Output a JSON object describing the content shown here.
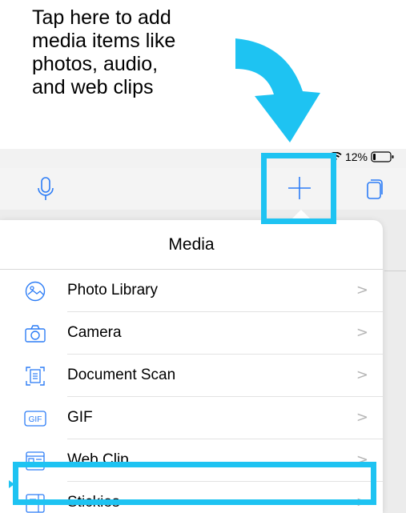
{
  "callout": {
    "text": "Tap here to add\nmedia items like\nphotos, audio,\nand web clips"
  },
  "status": {
    "battery": "12%"
  },
  "colors": {
    "accent": "#1ec3f2",
    "icon": "#2d7df6"
  },
  "toolbar": {
    "mic_icon": "microphone-icon",
    "add_icon": "plus-icon",
    "pages_icon": "pages-icon"
  },
  "popover": {
    "title": "Media",
    "items": [
      {
        "label": "Photo Library",
        "icon": "photo-library-icon"
      },
      {
        "label": "Camera",
        "icon": "camera-icon"
      },
      {
        "label": "Document Scan",
        "icon": "document-scan-icon"
      },
      {
        "label": "GIF",
        "icon": "gif-icon"
      },
      {
        "label": "Web Clip",
        "icon": "web-clip-icon"
      },
      {
        "label": "Stickies",
        "icon": "stickies-icon"
      }
    ],
    "chevron": ">"
  },
  "gif_badge": "GIF"
}
